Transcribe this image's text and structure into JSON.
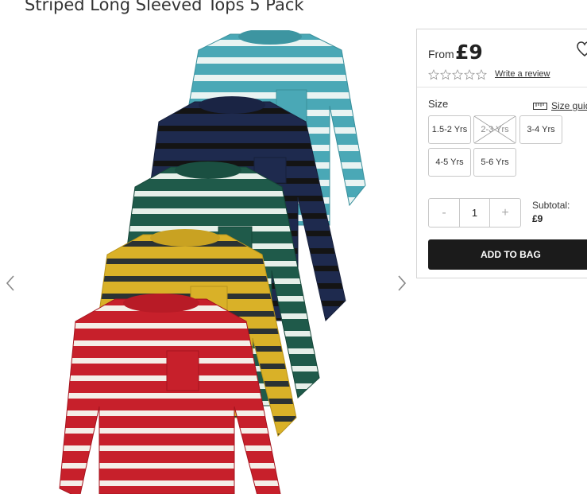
{
  "product": {
    "title": "Striped Long Sleeved Tops 5 Pack",
    "image_alt": "five striped long sleeved tops in teal, navy, green, mustard and red"
  },
  "panel": {
    "from_label": "From",
    "price": "£9",
    "review_link": "Write a review",
    "rating_stars": 0,
    "size_label": "Size",
    "size_guide_label": "Size guide",
    "sizes": [
      {
        "label": "1.5-2 Yrs",
        "available": true
      },
      {
        "label": "2-3 Yrs",
        "available": false
      },
      {
        "label": "3-4 Yrs",
        "available": true
      },
      {
        "label": "4-5 Yrs",
        "available": true
      },
      {
        "label": "5-6 Yrs",
        "available": true
      }
    ],
    "quantity": {
      "minus": "-",
      "value": "1",
      "plus": "+"
    },
    "subtotal_label": "Subtotal:",
    "subtotal_value": "£9",
    "add_to_bag": "ADD TO BAG"
  },
  "icons": {
    "prev": "chevron-left-icon",
    "next": "chevron-right-icon",
    "wishlist": "heart-icon",
    "size_guide": "ruler-icon"
  },
  "colors": {
    "teal": "#4aa8b6",
    "navy": "#1e2a4e",
    "green": "#1f5a4a",
    "mustard": "#d9b128",
    "red": "#c7202b",
    "button": "#1b1b1b"
  }
}
